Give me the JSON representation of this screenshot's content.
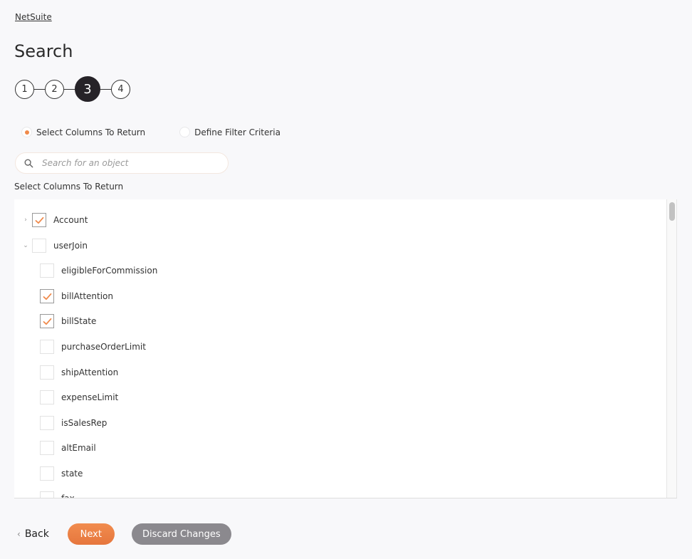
{
  "breadcrumb": {
    "label": "NetSuite"
  },
  "page": {
    "title": "Search"
  },
  "stepper": {
    "steps": [
      "1",
      "2",
      "3",
      "4"
    ],
    "active_step": "3"
  },
  "mode": {
    "options": [
      {
        "label": "Select Columns To Return",
        "selected": true
      },
      {
        "label": "Define Filter Criteria",
        "selected": false
      }
    ]
  },
  "search": {
    "placeholder": "Search for an object",
    "value": ""
  },
  "columns": {
    "label": "Select Columns To Return",
    "items": [
      {
        "label": "Account",
        "level": 0,
        "expander": "collapsed",
        "checked": true
      },
      {
        "label": "userJoin",
        "level": 0,
        "expander": "expanded",
        "checked": false
      },
      {
        "label": "eligibleForCommission",
        "level": 1,
        "checked": false
      },
      {
        "label": "billAttention",
        "level": 1,
        "checked": true
      },
      {
        "label": "billState",
        "level": 1,
        "checked": true
      },
      {
        "label": "purchaseOrderLimit",
        "level": 1,
        "checked": false
      },
      {
        "label": "shipAttention",
        "level": 1,
        "checked": false
      },
      {
        "label": "expenseLimit",
        "level": 1,
        "checked": false
      },
      {
        "label": "isSalesRep",
        "level": 1,
        "checked": false
      },
      {
        "label": "altEmail",
        "level": 1,
        "checked": false
      },
      {
        "label": "state",
        "level": 1,
        "checked": false
      },
      {
        "label": "fax",
        "level": 1,
        "checked": false
      }
    ]
  },
  "footer": {
    "back_label": "Back",
    "next_label": "Next",
    "discard_label": "Discard Changes"
  },
  "colors": {
    "accent": "#f08a4b",
    "active_step": "#262328",
    "discard": "#8b898e"
  }
}
